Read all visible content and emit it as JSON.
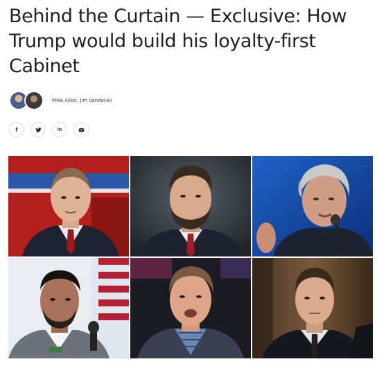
{
  "article": {
    "headline": "Behind the Curtain — Exclusive: How Trump would build his loyalty-first Cabinet",
    "authors": "Mike Allen, Jim VandeHei"
  },
  "share": [
    {
      "label": "f",
      "icon": "facebook-icon"
    },
    {
      "label": "twitter",
      "icon": "twitter-icon"
    },
    {
      "label": "in",
      "icon": "linkedin-icon"
    },
    {
      "label": "email",
      "icon": "email-icon"
    }
  ],
  "photos": [
    {
      "icon": "portrait-bald-man-red-tie-photo"
    },
    {
      "icon": "portrait-bearded-man-red-tie-photo"
    },
    {
      "icon": "portrait-gray-haired-man-microphone-photo"
    },
    {
      "icon": "portrait-man-speaking-flag-photo"
    },
    {
      "icon": "portrait-man-speaking-plaid-shirt-photo"
    },
    {
      "icon": "portrait-man-suit-hearing-photo"
    }
  ]
}
